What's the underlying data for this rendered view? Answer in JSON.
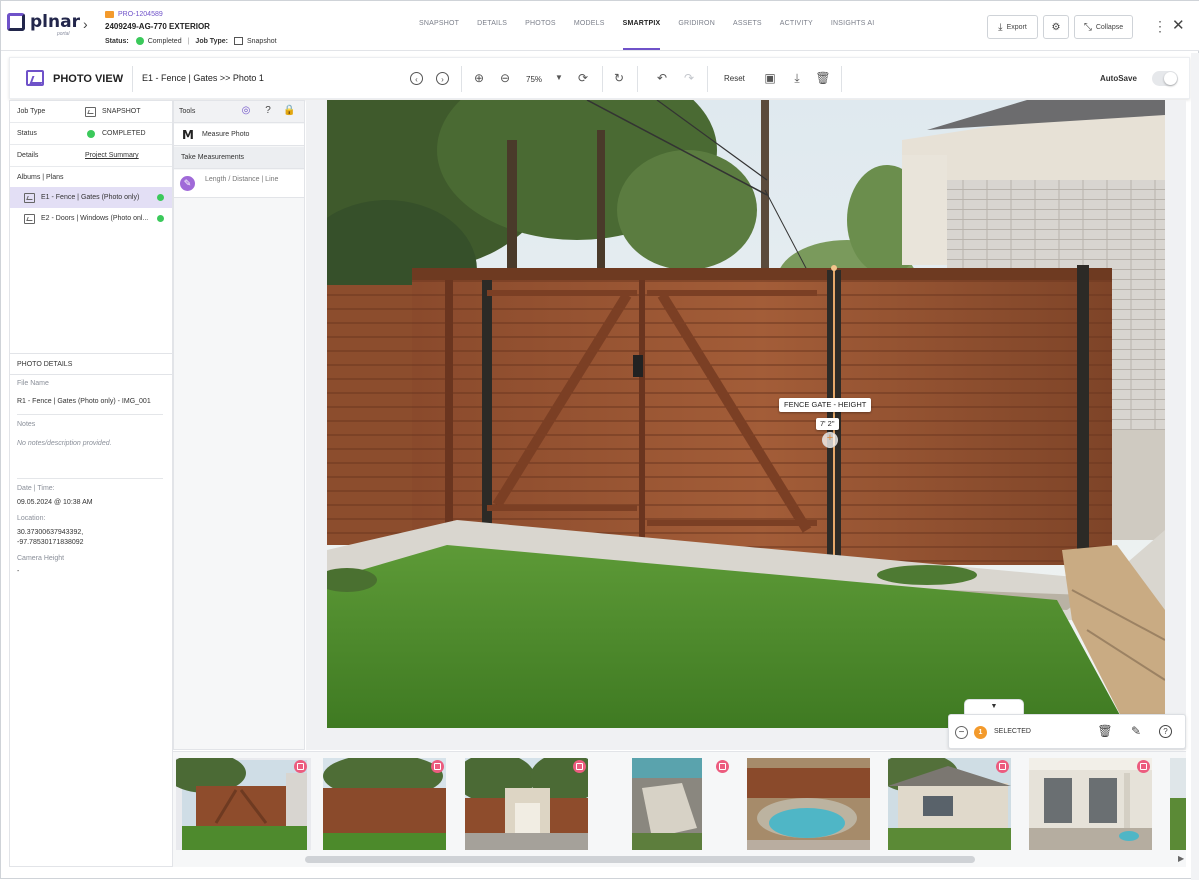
{
  "brand": {
    "name": "plnar",
    "sub": "portal"
  },
  "project": {
    "id": "PRO-1204589",
    "name": "2409249-AG-770 EXTERIOR",
    "status_label": "Status:",
    "status": "Completed",
    "job_type_label": "Job Type:",
    "job_type": "Snapshot"
  },
  "nav": {
    "tabs": [
      "SNAPSHOT",
      "DETAILS",
      "PHOTOS",
      "MODELS",
      "SMARTPIX",
      "GRIDIRON",
      "ASSETS",
      "ACTIVITY",
      "INSIGHTS AI"
    ],
    "active": "SMARTPIX"
  },
  "header_buttons": {
    "export": "Export",
    "collapse": "Collapse"
  },
  "toolbar": {
    "title": "PHOTO VIEW",
    "breadcrumb": "E1 - Fence | Gates >> Photo 1",
    "zoom": "75%",
    "reset": "Reset",
    "autosave": "AutoSave"
  },
  "left": {
    "job_type_label": "Job Type",
    "job_type_value": "SNAPSHOT",
    "status_label": "Status",
    "status_value": "COMPLETED",
    "details_label": "Details",
    "details_link": "Project Summary",
    "albums_label": "Albums | Plans",
    "albums": [
      {
        "label": "E1 - Fence | Gates (Photo only)",
        "active": true
      },
      {
        "label": "E2 - Doors | Windows (Photo onl...",
        "active": false
      }
    ],
    "photo_details": {
      "heading": "PHOTO DETAILS",
      "file_name_label": "File Name",
      "file_name": "R1 - Fence | Gates (Photo only) - IMG_001",
      "notes_label": "Notes",
      "notes": "No notes/description provided.",
      "datetime_label": "Date | Time:",
      "datetime": "09.05.2024 @ 10:38 AM",
      "location_label": "Location:",
      "location_lines": [
        "30.37300637943392,",
        "-97.78530171838092"
      ],
      "camera_label": "Camera Height",
      "camera_value": "-"
    }
  },
  "tools": {
    "heading": "Tools",
    "measure_photo": "Measure Photo",
    "take_measurements": "Take Measurements",
    "length_tool": "Length / Distance | Line"
  },
  "measurement": {
    "label": "FENCE GATE - HEIGHT",
    "value": "7' 2\""
  },
  "selection": {
    "count": "1",
    "label": "SELECTED"
  },
  "colors": {
    "accent": "#6f52c9",
    "success": "#3bc95b",
    "badge": "#ec5c7f",
    "warning": "#f39a2c"
  }
}
